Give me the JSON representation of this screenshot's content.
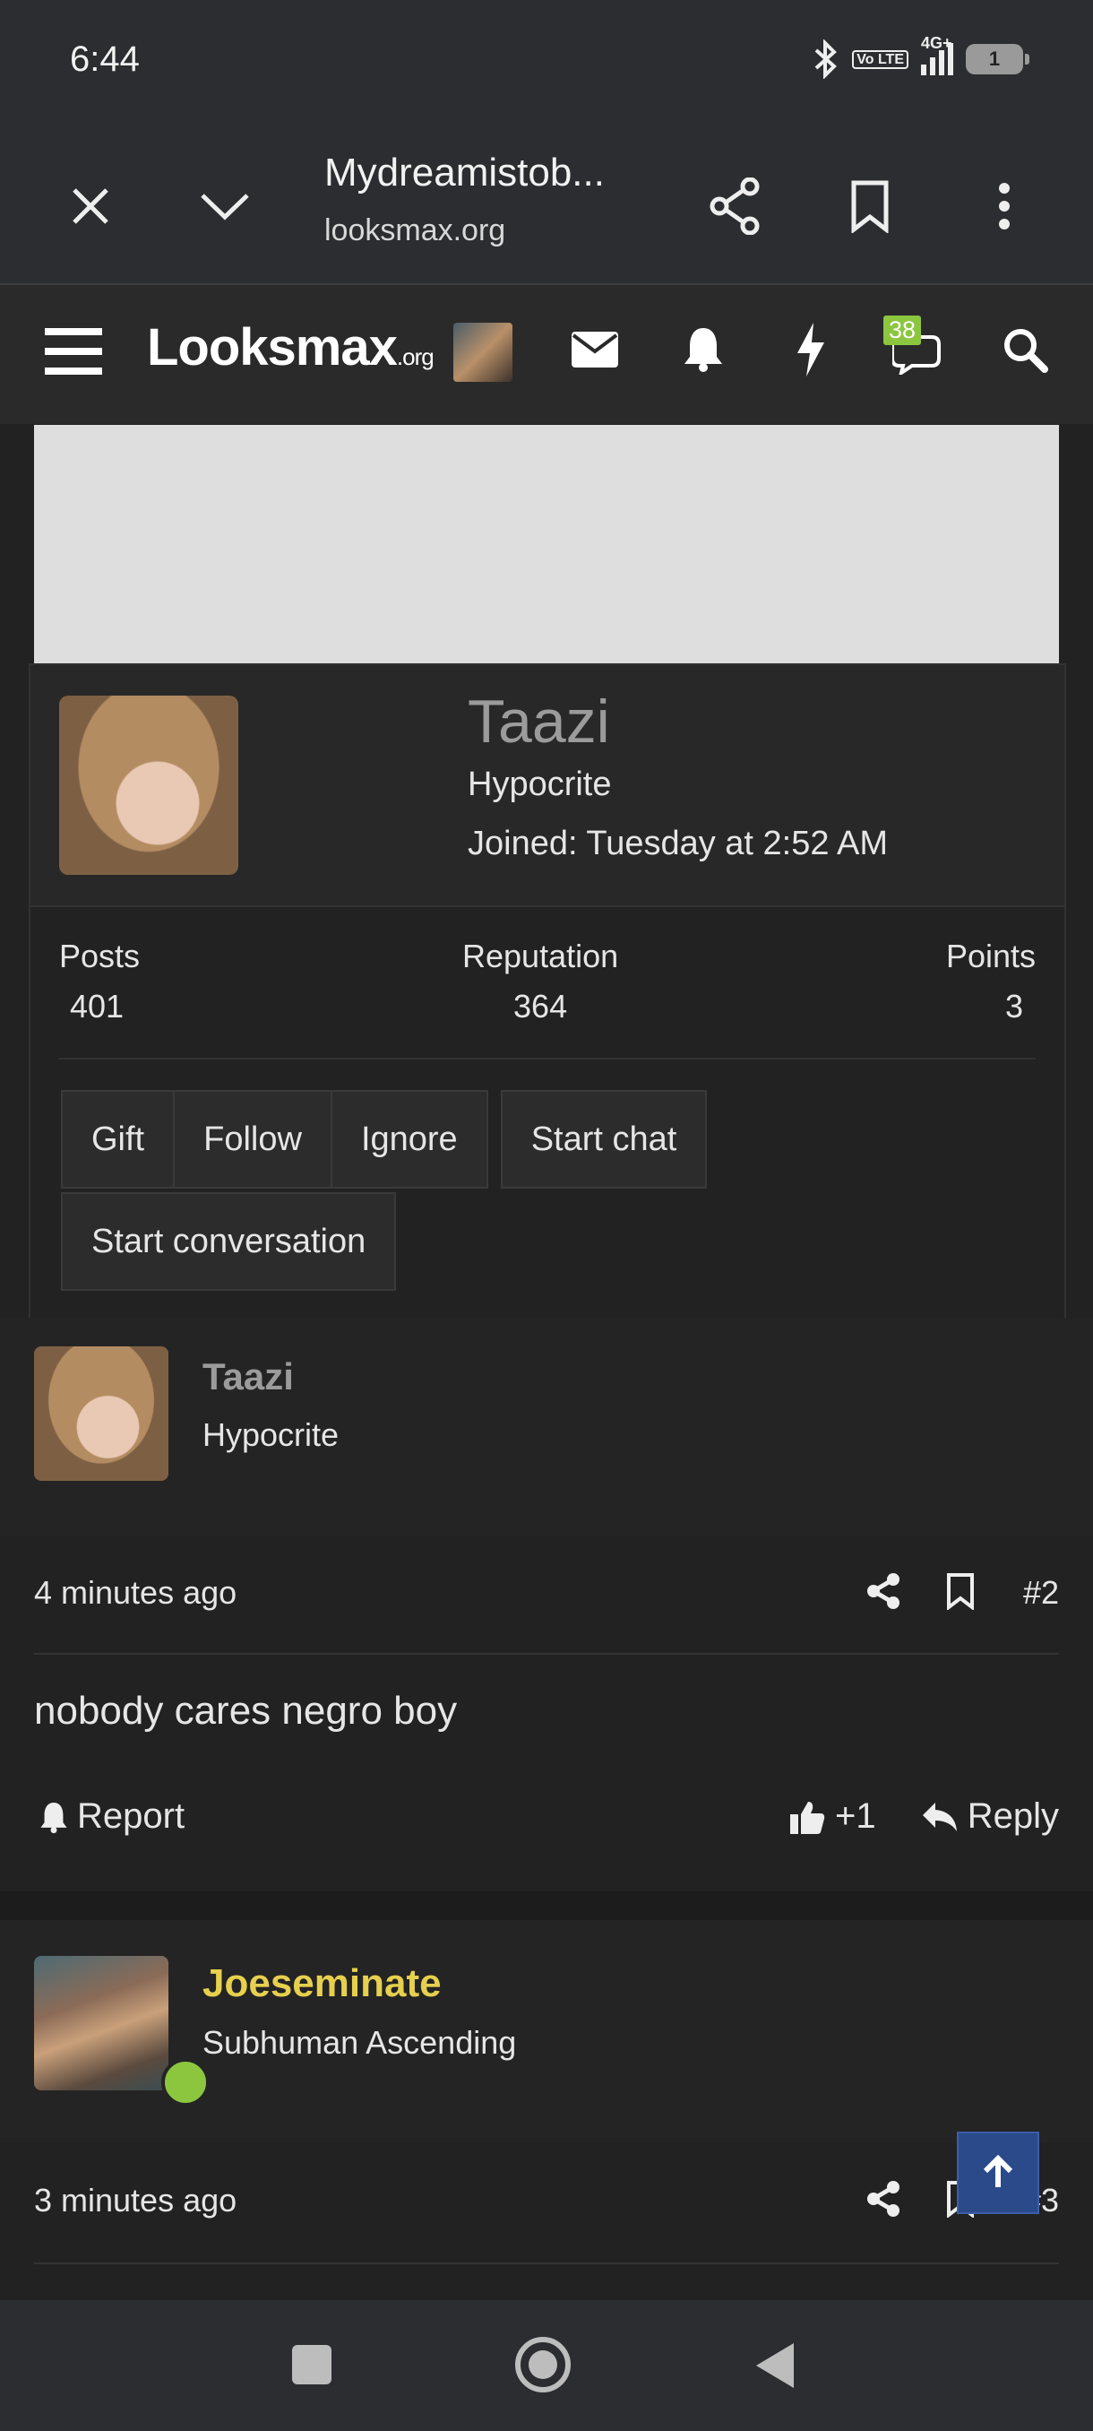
{
  "status_bar": {
    "time": "6:44",
    "network": "4G+",
    "volte": "Vo LTE",
    "battery": "1"
  },
  "browser": {
    "title": "Mydreamistob...",
    "url": "looksmax.org"
  },
  "site": {
    "logo_main": "Looksmax",
    "logo_suffix": ".org",
    "chat_badge": "38"
  },
  "popup": {
    "name": "Taazi",
    "user_title": "Hypocrite",
    "joined": "Joined: Tuesday at 2:52 AM",
    "stats": [
      {
        "label": "Posts",
        "value": "401"
      },
      {
        "label": "Reputation",
        "value": "364"
      },
      {
        "label": "Points",
        "value": "3"
      }
    ],
    "buttons": [
      "Gift",
      "Follow",
      "Ignore",
      "Start chat",
      "Start conversation"
    ]
  },
  "post1": {
    "author": "Taazi",
    "author_title": "Hypocrite",
    "time": "4 minutes ago",
    "number": "#2",
    "body": "nobody cares negro boy",
    "report_label": "Report",
    "like_count": "+1",
    "reply_label": "Reply"
  },
  "post2": {
    "author": "Joeseminate",
    "author_title": "Subhuman Ascending",
    "time": "3 minutes ago",
    "number": "#3"
  },
  "colors": {
    "accent_green": "#8cc63f",
    "username_gold": "#e6d04e",
    "scroll_button": "#2a4a8a"
  }
}
